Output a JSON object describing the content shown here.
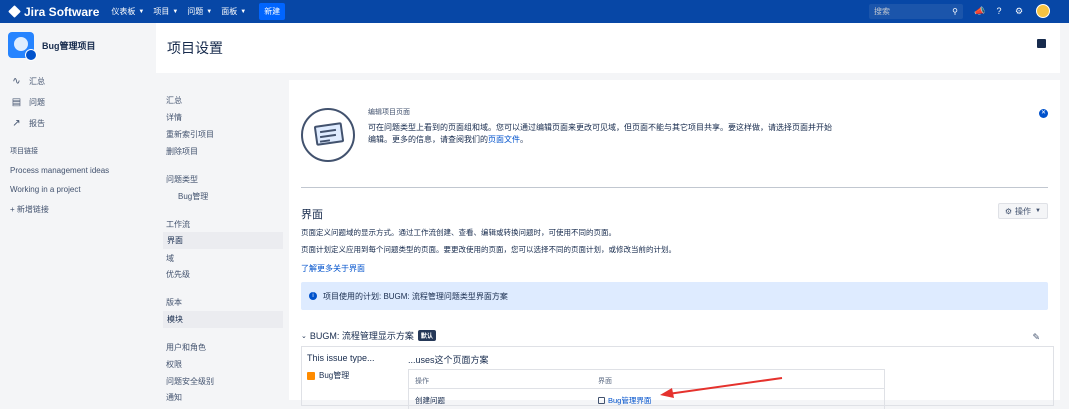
{
  "topnav": {
    "logo_word": "Jira Software",
    "menu": [
      "仪表板",
      "项目",
      "问题",
      "面板"
    ],
    "create_label": "新建",
    "search_placeholder": "搜索"
  },
  "sidebar": {
    "project_name": "Bug管理项目",
    "items": [
      {
        "label": "汇总",
        "icon": "pulse-icon"
      },
      {
        "label": "问题",
        "icon": "issues-icon"
      },
      {
        "label": "报告",
        "icon": "chart-icon"
      }
    ],
    "section_label": "项目链接",
    "links": [
      "Process management ideas",
      "Working in a project"
    ],
    "add_link_label": "新增链接"
  },
  "header": {
    "title": "项目设置"
  },
  "subnav": {
    "items": [
      {
        "label": "汇总"
      },
      {
        "label": "详情"
      },
      {
        "label": "重新索引项目"
      },
      {
        "label": "删除项目"
      },
      {
        "label": "问题类型"
      },
      {
        "label": "Bug管理"
      },
      {
        "label": "工作流"
      },
      {
        "label": "界面"
      },
      {
        "label": "域"
      },
      {
        "label": "优先级"
      },
      {
        "label": "版本"
      },
      {
        "label": "模块"
      },
      {
        "label": "用户和角色"
      },
      {
        "label": "权限"
      },
      {
        "label": "问题安全级别"
      },
      {
        "label": "通知"
      }
    ],
    "active": "界面"
  },
  "banner": {
    "title": "编辑项目页面",
    "text_prefix": "可在问题类型上看到的页面组和域。您可以通过编辑页面来更改可见域，但页面不能与其它项目共享。要这样做，请选择页面并开始编辑。更多的信息，请查阅我们的",
    "link": "页面文件",
    "text_suffix": "。"
  },
  "section": {
    "title": "界面",
    "ops_label": "操作",
    "para1": "页面定义问题域的显示方式。通过工作流创建、查看、编辑或转换问题时，可使用不同的页面。",
    "para2": "页面计划定义应用到每个问题类型的页面。要更改使用的页面，您可以选择不同的页面计划，或修改当前的计划。",
    "learn_more": "了解更多关于界面",
    "info_text": "项目使用的计划: BUGM: 流程管理问题类型界面方案"
  },
  "scheme": {
    "title": "BUGM: 流程管理显示方案",
    "badge": "默认",
    "col1_label": "This issue type...",
    "col2_label": "...uses这个页面方案",
    "issue_type": "Bug管理",
    "table_headers": [
      "操作",
      "界面"
    ],
    "rows": [
      {
        "operation": "创建问题",
        "screen": "Bug管理界面"
      }
    ]
  },
  "colors": {
    "topnav": "#0747a6",
    "link": "#0052cc",
    "info_bg": "#deebff",
    "arrow": "#e5322d"
  }
}
